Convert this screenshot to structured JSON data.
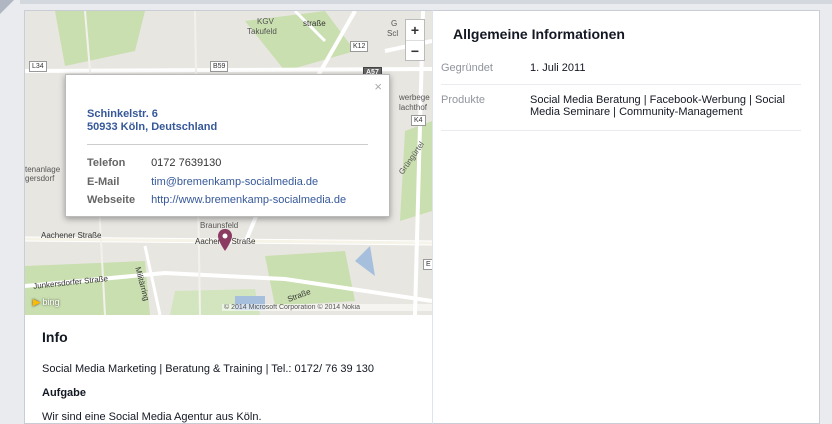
{
  "map": {
    "labels": {
      "kgv": "KGV",
      "takufeld": "Takufeld",
      "strasse_top": "straße",
      "l34": "L34",
      "b59": "B59",
      "k12": "K12",
      "a57": "A57",
      "gewerbe": "werbege",
      "lachthof": "lachthof",
      "k4": "K4",
      "gruen": "Grüngürtel",
      "tenanlage": "tenanlage",
      "gersdorf": "gersdorf",
      "bickendorf_left": "G",
      "bickendorf_left2": "Scl",
      "braunsfeld": "Braunsfeld",
      "aachener1": "Aachener Straße",
      "aachener2": "Aachener Straße",
      "junkersdorfer": "Junkersdorfer Straße",
      "militaer": "Militärring",
      "strasse_bottom": "Straße",
      "e": "E",
      "bing": "bing",
      "copyright": "© 2014 Microsoft Corporation  © 2014 Nokia"
    },
    "zoom_in": "+",
    "zoom_out": "−"
  },
  "popup": {
    "close": "×",
    "address_line1": "Schinkelstr. 6",
    "address_line2": "50933 Köln, Deutschland",
    "phone_label": "Telefon",
    "phone_value": "0172 7639130",
    "email_label": "E-Mail",
    "email_value": "tim@bremenkamp-socialmedia.de",
    "web_label": "Webseite",
    "web_value": "http://www.bremenkamp-socialmedia.de"
  },
  "info": {
    "title": "Info",
    "line1": "Social Media Marketing | Beratung & Training | Tel.: 0172/ 76 39 130",
    "task_label": "Aufgabe",
    "task_text": "Wir sind eine Social Media Agentur aus Köln."
  },
  "general": {
    "title": "Allgemeine Informationen",
    "founded_label": "Gegründet",
    "founded_value": "1. Juli 2011",
    "products_label": "Produkte",
    "products_value": "Social Media Beratung | Facebook-Werbung | Social Media Seminare | Community-Management"
  },
  "colors": {
    "link": "#365899",
    "pin": "#8b3a62",
    "park": "#c9dfaf",
    "water": "#a5bfdd"
  }
}
